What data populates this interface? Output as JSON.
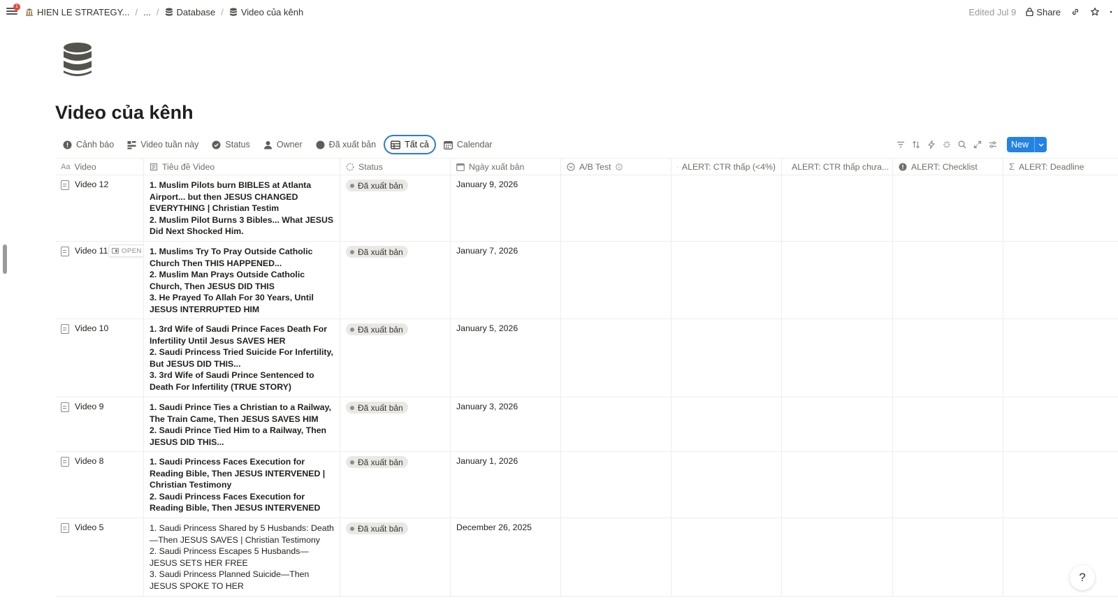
{
  "topbar": {
    "notification_count": "1",
    "workspace": "HIEN LE STRATEGY...",
    "ellipsis": "...",
    "crumb_database": "Database",
    "crumb_page": "Video của kênh",
    "edited": "Edited Jul 9",
    "share": "Share"
  },
  "page": {
    "title": "Video của kênh"
  },
  "views": [
    {
      "label": "Cảnh báo"
    },
    {
      "label": "Video tuần này"
    },
    {
      "label": "Status"
    },
    {
      "label": "Owner"
    },
    {
      "label": "Đã xuất bản"
    },
    {
      "label": "Tất cả"
    },
    {
      "label": "Calendar"
    }
  ],
  "toolbar": {
    "new_label": "New"
  },
  "columns": [
    {
      "label": "Video",
      "icon": "title-icon"
    },
    {
      "label": "Tiêu đề Video",
      "icon": "text-icon"
    },
    {
      "label": "Status",
      "icon": "status-icon"
    },
    {
      "label": "Ngày xuất bản",
      "icon": "calendar-icon"
    },
    {
      "label": "A/B Test",
      "icon": "select-icon"
    },
    {
      "label": "ALERT: CTR thấp (<4%)",
      "icon": "alert-icon"
    },
    {
      "label": "ALERT: CTR thấp chưa...",
      "icon": "alert-icon"
    },
    {
      "label": "ALERT: Checklist",
      "icon": "alert-icon"
    },
    {
      "label": "ALERT: Deadline",
      "icon": "sigma-icon"
    }
  ],
  "open_label": "OPEN",
  "rows": [
    {
      "name": "Video 12",
      "lines": [
        {
          "text": "1. Muslim Pilots burn BIBLES at Atlanta Airport... but then JESUS CHANGED EVERYTHING | Christian Testim",
          "bold": true
        },
        {
          "text": "2. Muslim Pilot Burns 3 Bibles... What JESUS Did Next Shocked Him.",
          "bold": true
        }
      ],
      "status": "Đã xuất bản",
      "date": "January 9, 2026"
    },
    {
      "name": "Video 11",
      "lines": [
        {
          "text": "1. Muslims Try To Pray Outside Catholic Church Then THIS HAPPENED...",
          "bold": true
        },
        {
          "text": "2. Muslim Man Prays Outside Catholic Church, Then JESUS DID THIS",
          "bold": true
        },
        {
          "text": "3. He Prayed To Allah For 30 Years, Until JESUS INTERRUPTED HIM",
          "bold": true
        }
      ],
      "status": "Đã xuất bản",
      "date": "January 7, 2026"
    },
    {
      "name": "Video 10",
      "lines": [
        {
          "text": "1. 3rd Wife of Saudi Prince Faces Death For Infertility Until Jesus SAVES HER",
          "bold": true
        },
        {
          "text": "2. Saudi Princess Tried Suicide For Infertility, But JESUS DID THIS...",
          "bold": true
        },
        {
          "text": "3. 3rd Wife of Saudi Prince Sentenced to Death For Infertility (TRUE STORY)",
          "bold": true
        }
      ],
      "status": "Đã xuất bản",
      "date": "January 5, 2026"
    },
    {
      "name": "Video 9",
      "lines": [
        {
          "text": "1. Saudi Prince Ties a Christian to a Railway, The Train Came, Then JESUS SAVES HIM",
          "bold": true
        },
        {
          "text": "2. Saudi Prince Tied Him to a Railway, Then JESUS DID THIS...",
          "bold": true
        }
      ],
      "status": "Đã xuất bản",
      "date": "January 3, 2026"
    },
    {
      "name": "Video 8",
      "lines": [
        {
          "text": "1. Saudi Princess Faces Execution for Reading Bible, Then JESUS INTERVENED | Christian Testimony",
          "bold": true
        },
        {
          "text": "2. Saudi Princess Faces Execution for Reading Bible, Then JESUS INTERVENED",
          "bold": true
        }
      ],
      "status": "Đã xuất bản",
      "date": "January 1, 2026"
    },
    {
      "name": "Video 5",
      "lines": [
        {
          "text": "1. Saudi Princess Shared by 5 Husbands: Death—Then JESUS SAVES | Christian Testimony",
          "bold": false
        },
        {
          "text": "2. Saudi Princess Escapes 5 Husbands—JESUS SETS HER FREE",
          "bold": false
        },
        {
          "text": "3. Saudi Princess Planned Suicide—Then JESUS SPOKE TO HER",
          "bold": false
        }
      ],
      "status": "Đã xuất bản",
      "date": "December 26, 2025"
    }
  ]
}
